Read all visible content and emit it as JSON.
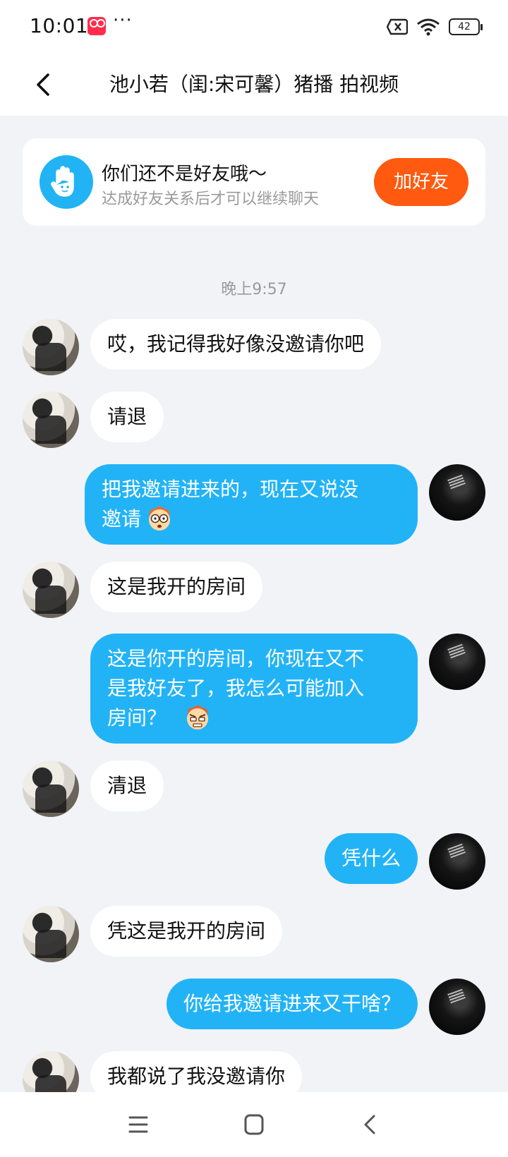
{
  "status": {
    "time": "10:01",
    "dots": "···",
    "battery": "42",
    "icons": [
      "app-badge-icon",
      "sim-off-icon",
      "wifi-icon",
      "battery-icon"
    ]
  },
  "header": {
    "title": "池小若（闺:宋可馨）猪播 拍视频"
  },
  "notice": {
    "title": "你们还不是好友哦～",
    "subtitle": "达成好友关系后才可以继续聊天",
    "button": "加好友"
  },
  "timestamp": "晚上9:57",
  "messages": [
    {
      "side": "left",
      "text": "哎，我记得我好像没邀请你吧"
    },
    {
      "side": "left",
      "text": "请退"
    },
    {
      "side": "right",
      "line1": "把我邀请进来的，现在又说没",
      "line2": "邀请",
      "emoji": "surprised-emoji-icon"
    },
    {
      "side": "left",
      "text": "这是我开的房间"
    },
    {
      "side": "right",
      "line1": "这是你开的房间，你现在又不",
      "line2": "是我好友了，我怎么可能加入",
      "line3": "房间？",
      "emoji": "angry-emoji-icon"
    },
    {
      "side": "left",
      "text": "清退"
    },
    {
      "side": "right",
      "text": "凭什么"
    },
    {
      "side": "left",
      "text": "凭这是我开的房间"
    },
    {
      "side": "right",
      "text": "你给我邀请进来又干啥？"
    },
    {
      "side": "left",
      "text": "我都说了我没邀请你"
    }
  ],
  "colors": {
    "accent_blue": "#22b3f7",
    "button_orange": "#ff5a0f",
    "background": "#f2f3f6"
  }
}
